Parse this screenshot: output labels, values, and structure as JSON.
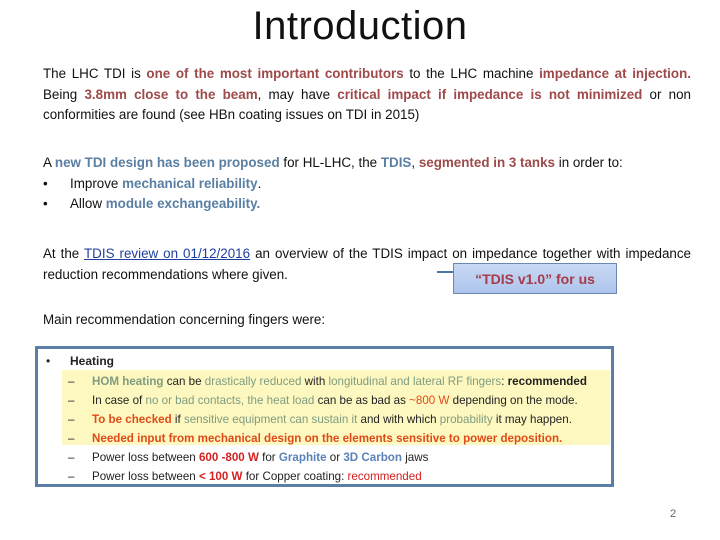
{
  "title": "Introduction",
  "p1": {
    "s1": "The LHC TDI is ",
    "s2": "one of the most important contributors",
    "s3": " to the LHC machine ",
    "s4": "impedance at injection.",
    "s5": " Being ",
    "s6": "3.8mm close to the beam",
    "s7": ", may have ",
    "s8": "critical impact if impedance is not minimized",
    "s9": " or non conformities are found (see HBn coating issues on TDI in  2015)"
  },
  "p2": {
    "s1": "A ",
    "s2": "new TDI design has been proposed",
    "s3": " for HL-LHC, the ",
    "s4": "TDIS",
    "s5": ", ",
    "s6": "segmented in 3 tanks",
    "s7": " in order to:",
    "bullets": [
      {
        "a": "Improve ",
        "b": "mechanical reliability",
        "c": "."
      },
      {
        "a": "Allow ",
        "b": "module exchangeability.",
        "c": ""
      }
    ],
    "bullet_char": "•"
  },
  "p3": {
    "s1": "At the ",
    "link": "TDIS review on 01/12/2016",
    "s2": " an overview of the TDIS impact on impedance together with impedance reduction recommendations where given."
  },
  "callout": "“TDIS v1.0” for us",
  "p4": "Main recommendation concerning fingers were:",
  "box": {
    "bullet_char": "•",
    "dash_char": "–",
    "heading": "Heating",
    "l1": {
      "a": "HOM heating",
      "b": " can be ",
      "c": "drastically reduced",
      "d": " with ",
      "e": "longitudinal and lateral RF fingers",
      "f": ": ",
      "g": "recommended"
    },
    "l2": {
      "a": "In case of ",
      "b": "no or bad contacts, the heat load",
      "c": "  can be as bad as ",
      "d": "~800 W",
      "e": " depending on the mode."
    },
    "l3": {
      "a": "To be checked",
      "b": "  if ",
      "c": "sensitive equipment can sustain it",
      "d": " and with which ",
      "e": "probability",
      "f": " it may happen."
    },
    "l4": "Needed input from mechanical design on the elements sensitive to power deposition.",
    "l5": {
      "a": "Power loss  between ",
      "b": "600 -800 W",
      "c": " for ",
      "d": "Graphite",
      "e": " or ",
      "f": "3D Carbon",
      "g": " jaws"
    },
    "l6": {
      "a": "Power loss  between ",
      "b": "< 100 W",
      "c": " for Copper coating: ",
      "d": "recommended"
    }
  },
  "page_number": "2",
  "colors": {
    "emphasis_red": "#9e4a4a",
    "emphasis_blue": "#5a7fa3",
    "box_border": "#5b7ea8",
    "highlight_yellow": "#fdf8c0",
    "callout_fill": "#b8cdf0",
    "callout_text": "#a73a4a"
  }
}
